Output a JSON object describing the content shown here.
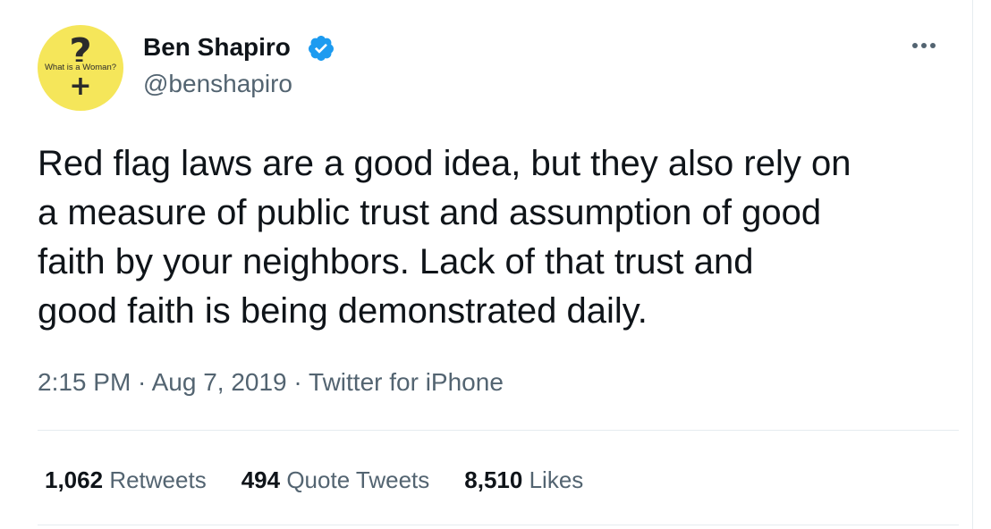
{
  "avatar": {
    "question_mark": "?",
    "cross": "+",
    "text": "What is a Woman?"
  },
  "user": {
    "name": "Ben Shapiro",
    "handle": "@benshapiro",
    "verified_icon": "verified-badge-icon"
  },
  "menu": {
    "icon": "more-horizontal-icon"
  },
  "tweet": {
    "lines": [
      "Red flag laws are a good idea, but they also rely on",
      "a measure of public trust and assumption of good",
      "faith by your neighbors. Lack of that trust and",
      "good faith is being demonstrated daily."
    ],
    "meta": "2:15 PM · Aug 7, 2019 · Twitter for iPhone"
  },
  "stats": {
    "retweets": {
      "count": "1,062",
      "label": "Retweets"
    },
    "quotes": {
      "count": "494",
      "label": "Quote Tweets"
    },
    "likes": {
      "count": "8,510",
      "label": "Likes"
    }
  },
  "colors": {
    "text": "#0f1419",
    "secondary": "#536471",
    "verified": "#1d9bf0",
    "avatar_bg": "#f5e65a"
  }
}
